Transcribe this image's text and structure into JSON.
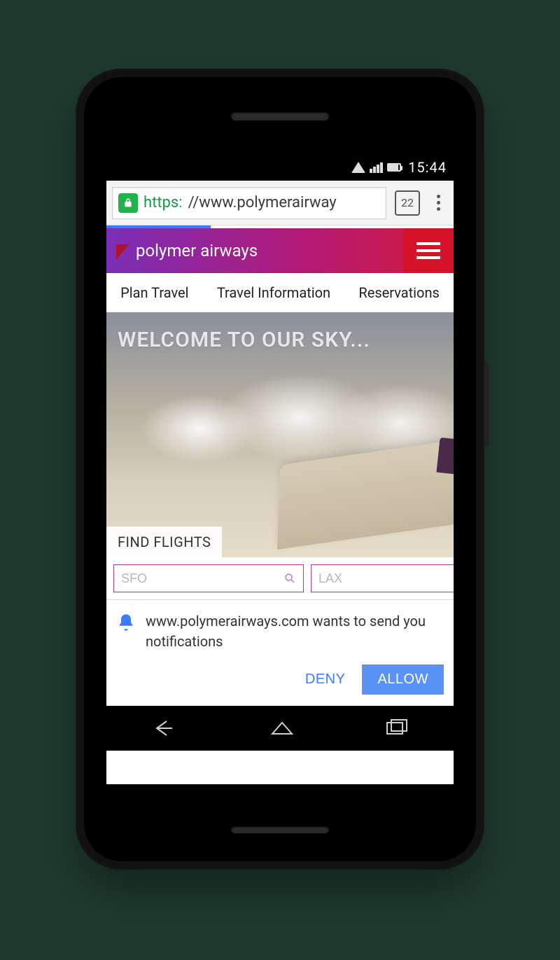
{
  "status_bar": {
    "time": "15:44"
  },
  "browser": {
    "url_https": "https:",
    "url_rest": "//www.polymerairway",
    "tab_count": "22"
  },
  "app": {
    "brand": "polymer airways",
    "nav": [
      "Plan Travel",
      "Travel Information",
      "Reservations"
    ]
  },
  "hero": {
    "title": "WELCOME TO OUR SKY...",
    "find_flights_label": "FIND FLIGHTS"
  },
  "search": {
    "from_placeholder": "SFO",
    "to_placeholder": "LAX"
  },
  "permission": {
    "text": "www.polymerairways.com wants to send you notifications",
    "deny": "DENY",
    "allow": "ALLOW"
  }
}
